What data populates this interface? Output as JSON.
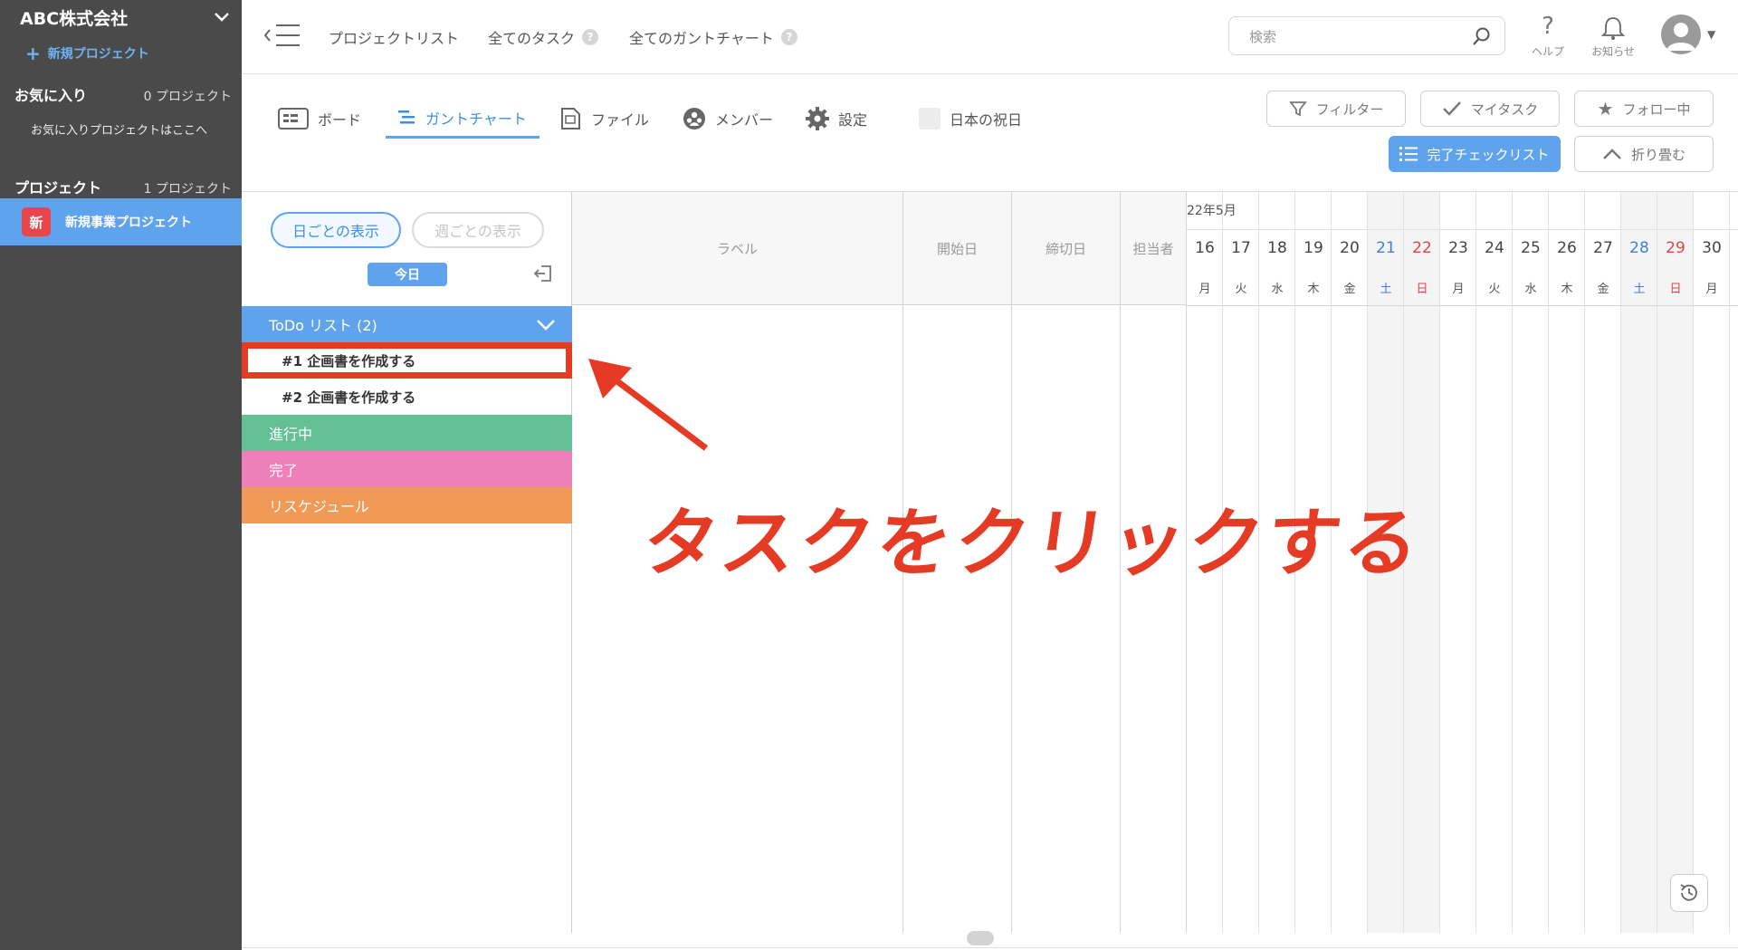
{
  "sidebar": {
    "company": "ABC株式会社",
    "new_project": "新規プロジェクト",
    "favorites_title": "お気に入り",
    "favorites_count": "0 プロジェクト",
    "favorites_hint": "お気に入りプロジェクトはここへ",
    "projects_title": "プロジェクト",
    "projects_count": "1 プロジェクト",
    "project_badge": "新",
    "project_name": "新規事業プロジェクト",
    "active_color": "#5ea3ec"
  },
  "header": {
    "nav": [
      "プロジェクトリスト",
      "全てのタスク",
      "全てのガントチャート"
    ],
    "help_mark": "?",
    "search_placeholder": "検索",
    "help_label": "ヘルプ",
    "notice_label": "お知らせ"
  },
  "toolbar": {
    "tabs": [
      "ボード",
      "ガントチャート",
      "ファイル",
      "メンバー",
      "設定"
    ],
    "active_tab": "ガントチャート",
    "holiday_label": "日本の祝日",
    "filter": "フィルター",
    "my_task": "マイタスク",
    "following": "フォロー中",
    "checklist": "完了チェックリスト",
    "collapse": "折り畳む"
  },
  "gantt": {
    "view_daily": "日ごとの表示",
    "view_weekly": "週ごとの表示",
    "today": "今日",
    "groups": {
      "todo": "ToDo リスト (2)",
      "in_progress": "進行中",
      "done": "完了",
      "reschedule": "リスケジュール"
    },
    "tasks": [
      "#1 企画書を作成する",
      "#2 企画書を作成する"
    ],
    "columns": [
      "ラベル",
      "開始日",
      "締切日",
      "担当者"
    ],
    "month": "22年5月",
    "days": [
      {
        "d": "16",
        "w": "月"
      },
      {
        "d": "17",
        "w": "火"
      },
      {
        "d": "18",
        "w": "水"
      },
      {
        "d": "19",
        "w": "木"
      },
      {
        "d": "20",
        "w": "金"
      },
      {
        "d": "21",
        "w": "土"
      },
      {
        "d": "22",
        "w": "日"
      },
      {
        "d": "23",
        "w": "月"
      },
      {
        "d": "24",
        "w": "火"
      },
      {
        "d": "25",
        "w": "水"
      },
      {
        "d": "26",
        "w": "木"
      },
      {
        "d": "27",
        "w": "金"
      },
      {
        "d": "28",
        "w": "土"
      },
      {
        "d": "29",
        "w": "日"
      },
      {
        "d": "30",
        "w": "月"
      }
    ],
    "saturday_color": "#3f7fd4",
    "sunday_color": "#e04545"
  },
  "annotation": {
    "text": "タスクをクリックする",
    "color": "#e53a24"
  }
}
